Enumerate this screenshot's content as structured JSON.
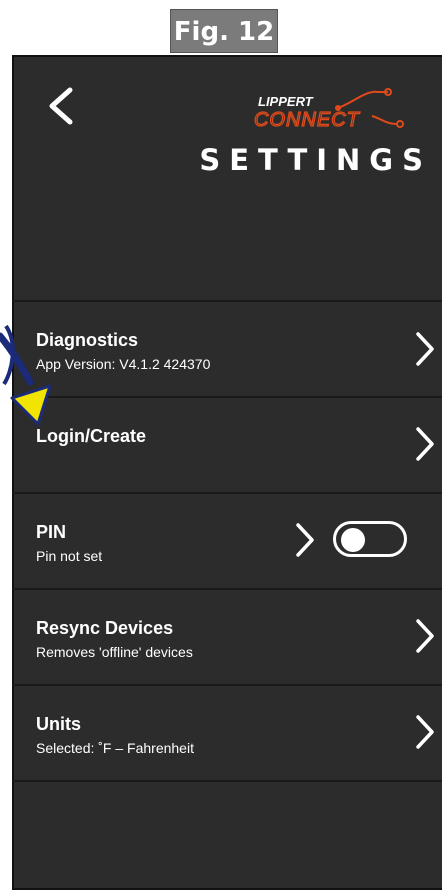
{
  "figure_label": "Fig. 12",
  "header": {
    "title": "SETTINGS",
    "logo_text_top": "LIPPERT",
    "logo_text_bottom": "CONNECT"
  },
  "settings": {
    "diagnostics": {
      "title": "Diagnostics",
      "subtitle": "App Version: V4.1.2 424370"
    },
    "login": {
      "title": "Login/Create"
    },
    "pin": {
      "title": "PIN",
      "subtitle": "Pin not set",
      "enabled": false
    },
    "resync": {
      "title": "Resync Devices",
      "subtitle": "Removes 'offline' devices"
    },
    "units": {
      "title": "Units",
      "subtitle": "Selected: ˚F – Fahrenheit"
    }
  },
  "colors": {
    "background": "#2c2c2c",
    "logo_accent": "#e04a1a",
    "annotation_arrow_fill": "#f0e400",
    "annotation_arrow_stroke": "#1c2a7a"
  }
}
